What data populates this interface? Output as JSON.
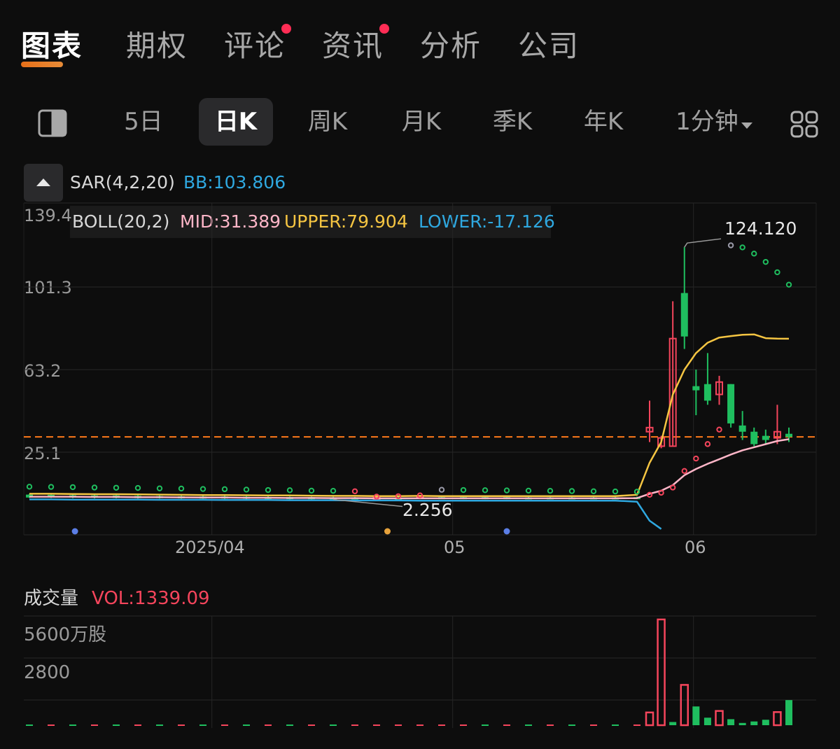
{
  "tabs": [
    {
      "label": "图表",
      "active": true
    },
    {
      "label": "期权",
      "active": false
    },
    {
      "label": "评论",
      "active": false,
      "dot": true
    },
    {
      "label": "资讯",
      "active": false,
      "dot": true
    },
    {
      "label": "分析",
      "active": false
    },
    {
      "label": "公司",
      "active": false
    }
  ],
  "periods": [
    {
      "label": "5日",
      "active": false
    },
    {
      "label": "日K",
      "active": true
    },
    {
      "label": "周K",
      "active": false
    },
    {
      "label": "月K",
      "active": false
    },
    {
      "label": "季K",
      "active": false
    },
    {
      "label": "年K",
      "active": false
    },
    {
      "label": "1分钟",
      "active": false,
      "dropdown": true
    }
  ],
  "icons": {
    "layout": "split-view-icon",
    "grid": "grid-icon",
    "collapse": "chevron-up-icon",
    "dropdown": "caret-down-icon"
  },
  "indicators": {
    "sar": {
      "label": "SAR(4,2,20)",
      "bb": "BB:103.806"
    },
    "boll": {
      "label": "BOLL(20,2)",
      "mid": "MID:31.389",
      "upper": "UPPER:79.904",
      "lower": "LOWER:-17.126"
    }
  },
  "colors": {
    "up": "#f5455c",
    "down": "#1fbe5f",
    "mid": "#ffb6c8",
    "upper": "#f5c542",
    "lower": "#2fa8e0",
    "last_price": "#ff7a1a",
    "bb": "#2fa8e0"
  },
  "chart_data": [
    {
      "type": "candlestick",
      "y_ticks": [
        "139.4",
        "101.3",
        "63.2",
        "25.1"
      ],
      "ylim": [
        -12,
        139.4
      ],
      "x_ticks": [
        {
          "label": "2025/04",
          "index": 8
        },
        {
          "label": "05",
          "index": 18
        },
        {
          "label": "06",
          "index": 28
        }
      ],
      "annotations": {
        "high": "124.120",
        "low": "2.256"
      },
      "last_price": 32.5,
      "candles": [
        {
          "o": 4.6,
          "h": 5,
          "l": 3,
          "c": 3.2
        },
        {
          "o": 4.5,
          "h": 4.8,
          "l": 3,
          "c": 3.3
        },
        {
          "o": 4.3,
          "h": 4.6,
          "l": 2.9,
          "c": 3.2
        },
        {
          "o": 4.2,
          "h": 4.5,
          "l": 2.8,
          "c": 3.1
        },
        {
          "o": 4.2,
          "h": 4.4,
          "l": 2.8,
          "c": 3
        },
        {
          "o": 4.0,
          "h": 4.3,
          "l": 2.7,
          "c": 2.9
        },
        {
          "o": 3.9,
          "h": 4.2,
          "l": 2.7,
          "c": 2.9
        },
        {
          "o": 3.8,
          "h": 4.1,
          "l": 2.6,
          "c": 2.8
        },
        {
          "o": 3.7,
          "h": 4.0,
          "l": 2.6,
          "c": 2.8
        },
        {
          "o": 3.7,
          "h": 4.0,
          "l": 2.5,
          "c": 2.7
        },
        {
          "o": 3.6,
          "h": 3.9,
          "l": 2.4,
          "c": 2.6
        },
        {
          "o": 3.5,
          "h": 3.8,
          "l": 2.3,
          "c": 2.5
        },
        {
          "o": 3.5,
          "h": 3.7,
          "l": 2.3,
          "c": 2.4
        },
        {
          "o": 3.4,
          "h": 3.6,
          "l": 2.3,
          "c": 2.4
        },
        {
          "o": 3.3,
          "h": 3.6,
          "l": 2.256,
          "c": 2.4
        },
        {
          "o": 3.3,
          "h": 3.5,
          "l": 2.3,
          "c": 2.5
        },
        {
          "o": 3.0,
          "h": 3.4,
          "l": 2.3,
          "c": 3.3
        },
        {
          "o": 3.2,
          "h": 3.5,
          "l": 2.4,
          "c": 2.6
        },
        {
          "o": 3.5,
          "h": 4.2,
          "l": 2.5,
          "c": 4
        },
        {
          "o": 3.4,
          "h": 3.7,
          "l": 2.5,
          "c": 2.7
        },
        {
          "o": 3.4,
          "h": 3.7,
          "l": 2.4,
          "c": 2.6
        },
        {
          "o": 3.4,
          "h": 3.6,
          "l": 2.4,
          "c": 2.6
        },
        {
          "o": 3.4,
          "h": 3.6,
          "l": 2.4,
          "c": 2.5
        },
        {
          "o": 3.3,
          "h": 3.6,
          "l": 2.3,
          "c": 2.5
        },
        {
          "o": 3.3,
          "h": 3.6,
          "l": 2.3,
          "c": 2.5
        },
        {
          "o": 3.3,
          "h": 3.6,
          "l": 2.3,
          "c": 2.5
        },
        {
          "o": 3.3,
          "h": 3.6,
          "l": 2.3,
          "c": 2.5
        },
        {
          "o": 3.3,
          "h": 3.6,
          "l": 2.4,
          "c": 2.6
        },
        {
          "o": 3.4,
          "h": 3.7,
          "l": 2.5,
          "c": 2.7
        },
        {
          "o": 35,
          "h": 50,
          "l": 30,
          "c": 37
        },
        {
          "o": 28,
          "h": 33,
          "l": 27,
          "c": 32
        },
        {
          "o": 28,
          "h": 98,
          "l": 28,
          "c": 80
        },
        {
          "o": 102,
          "h": 124.12,
          "l": 75,
          "c": 81
        },
        {
          "o": 57,
          "h": 65,
          "l": 43,
          "c": 55
        },
        {
          "o": 58,
          "h": 73,
          "l": 48,
          "c": 50
        },
        {
          "o": 53,
          "h": 62,
          "l": 48,
          "c": 59
        },
        {
          "o": 58,
          "h": 58,
          "l": 37,
          "c": 39
        },
        {
          "o": 38,
          "h": 45,
          "l": 31,
          "c": 35
        },
        {
          "o": 35,
          "h": 37,
          "l": 28,
          "c": 29
        },
        {
          "o": 33,
          "h": 36,
          "l": 29,
          "c": 31
        },
        {
          "o": 32,
          "h": 48,
          "l": 29,
          "c": 35
        },
        {
          "o": 34,
          "h": 37,
          "l": 30,
          "c": 32.5
        }
      ],
      "boll_mid": [
        3.6,
        3.6,
        3.6,
        3.5,
        3.5,
        3.4,
        3.4,
        3.3,
        3.2,
        3.2,
        3.1,
        3.1,
        3,
        3,
        2.9,
        2.9,
        2.8,
        2.8,
        2.8,
        2.8,
        2.8,
        2.8,
        2.8,
        2.8,
        2.8,
        2.8,
        2.8,
        2.8,
        2.9,
        5,
        6.5,
        9.2,
        14,
        17,
        19.5,
        21.7,
        24,
        26,
        27.5,
        29,
        30.5,
        31.389
      ],
      "boll_upper": [
        5,
        5,
        4.9,
        4.8,
        4.8,
        4.7,
        4.6,
        4.5,
        4.4,
        4.4,
        4.3,
        4.2,
        4.2,
        4.1,
        4,
        4,
        3.9,
        3.9,
        4,
        3.9,
        3.9,
        3.9,
        3.9,
        3.9,
        3.9,
        3.9,
        3.9,
        3.9,
        4.5,
        20,
        30,
        53,
        65,
        73,
        78,
        80.5,
        81.2,
        81.8,
        82,
        80.2,
        80,
        79.904
      ],
      "boll_lower": [
        2.3,
        2.3,
        2.2,
        2.2,
        2.2,
        2.2,
        2.1,
        2.1,
        2.1,
        2,
        2,
        2,
        1.9,
        1.9,
        1.9,
        1.8,
        1.8,
        1.8,
        1.7,
        1.7,
        1.7,
        1.7,
        1.7,
        1.7,
        1.7,
        1.7,
        1.7,
        1.7,
        1.2,
        -8,
        -12
      ],
      "sar": [
        {
          "i": 0,
          "v": 6.4,
          "c": "#1fbe5f"
        },
        {
          "i": 1,
          "v": 6.3,
          "c": "#1fbe5f"
        },
        {
          "i": 2,
          "v": 6.2,
          "c": "#1fbe5f"
        },
        {
          "i": 3,
          "v": 6.0,
          "c": "#1fbe5f"
        },
        {
          "i": 4,
          "v": 5.9,
          "c": "#1fbe5f"
        },
        {
          "i": 5,
          "v": 5.8,
          "c": "#1fbe5f"
        },
        {
          "i": 6,
          "v": 5.6,
          "c": "#1fbe5f"
        },
        {
          "i": 7,
          "v": 5.5,
          "c": "#1fbe5f"
        },
        {
          "i": 8,
          "v": 5.3,
          "c": "#1fbe5f"
        },
        {
          "i": 9,
          "v": 5.2,
          "c": "#1fbe5f"
        },
        {
          "i": 10,
          "v": 5.0,
          "c": "#1fbe5f"
        },
        {
          "i": 11,
          "v": 4.8,
          "c": "#1fbe5f"
        },
        {
          "i": 12,
          "v": 4.7,
          "c": "#1fbe5f"
        },
        {
          "i": 13,
          "v": 4.5,
          "c": "#1fbe5f"
        },
        {
          "i": 14,
          "v": 4.4,
          "c": "#1fbe5f"
        },
        {
          "i": 15,
          "v": 4.2,
          "c": "#f5455c"
        },
        {
          "i": 16,
          "v": 1.6,
          "c": "#f5455c"
        },
        {
          "i": 17,
          "v": 1.8,
          "c": "#f5455c"
        },
        {
          "i": 18,
          "v": 2.2,
          "c": "#f5455c"
        },
        {
          "i": 19,
          "v": 4.9,
          "c": "#9a9aa8"
        },
        {
          "i": 20,
          "v": 4.8,
          "c": "#1fbe5f"
        },
        {
          "i": 21,
          "v": 4.7,
          "c": "#1fbe5f"
        },
        {
          "i": 22,
          "v": 4.6,
          "c": "#1fbe5f"
        },
        {
          "i": 23,
          "v": 4.5,
          "c": "#1fbe5f"
        },
        {
          "i": 24,
          "v": 4.4,
          "c": "#1fbe5f"
        },
        {
          "i": 25,
          "v": 4.3,
          "c": "#1fbe5f"
        },
        {
          "i": 26,
          "v": 4.2,
          "c": "#1fbe5f"
        },
        {
          "i": 27,
          "v": 4.1,
          "c": "#1fbe5f"
        },
        {
          "i": 28,
          "v": 4.0,
          "c": "#1fbe5f"
        },
        {
          "i": 29,
          "v": 2.5,
          "c": "#f5455c"
        },
        {
          "i": 30,
          "v": 3.5,
          "c": "#f5455c"
        },
        {
          "i": 31,
          "v": 6,
          "c": "#f5455c"
        },
        {
          "i": 32,
          "v": 14,
          "c": "#f5455c"
        },
        {
          "i": 33,
          "v": 20,
          "c": "#f5455c"
        },
        {
          "i": 34,
          "v": 27,
          "c": "#f5455c"
        },
        {
          "i": 35,
          "v": 34,
          "c": "#f5455c"
        },
        {
          "i": 36,
          "v": 123,
          "c": "#9a9aa8"
        },
        {
          "i": 37,
          "v": 122,
          "c": "#1fbe5f"
        },
        {
          "i": 38,
          "v": 119,
          "c": "#1fbe5f"
        },
        {
          "i": 39,
          "v": 115,
          "c": "#1fbe5f"
        },
        {
          "i": 40,
          "v": 110,
          "c": "#1fbe5f"
        },
        {
          "i": 41,
          "v": 104,
          "c": "#1fbe5f"
        }
      ],
      "markers": [
        {
          "i": -3,
          "c": "#5b7ee6"
        },
        {
          "i": 16.5,
          "c": "#e6a23c"
        },
        {
          "i": 22,
          "c": "#5b7ee6"
        }
      ]
    },
    {
      "type": "bar",
      "title": "成交量",
      "value_label": "VOL:1339.09",
      "y_ticks": [
        "5600万股",
        "2800"
      ],
      "ylim": [
        0,
        5600
      ],
      "values": [
        20,
        20,
        20,
        20,
        20,
        20,
        20,
        20,
        20,
        20,
        20,
        20,
        20,
        20,
        20,
        20,
        20,
        20,
        20,
        20,
        20,
        20,
        20,
        20,
        20,
        20,
        20,
        20,
        20,
        680,
        5640,
        170,
        2150,
        1000,
        400,
        760,
        320,
        120,
        200,
        290,
        700,
        1340
      ],
      "colors": [
        "#1fbe5f",
        "#f5455c",
        "#1fbe5f",
        "#f5455c",
        "#1fbe5f",
        "#f5455c",
        "#1fbe5f",
        "#f5455c",
        "#1fbe5f",
        "#f5455c",
        "#1fbe5f",
        "#f5455c",
        "#1fbe5f",
        "#f5455c",
        "#1fbe5f",
        "#f5455c",
        "#f5455c",
        "#f5455c",
        "#f5455c",
        "#f5455c",
        "#f5455c",
        "#1fbe5f",
        "#f5455c",
        "#1fbe5f",
        "#f5455c",
        "#1fbe5f",
        "#f5455c",
        "#1fbe5f",
        "#f5455c",
        "#f5455c",
        "#f5455c",
        "#1fbe5f",
        "#f5455c",
        "#1fbe5f",
        "#1fbe5f",
        "#f5455c",
        "#1fbe5f",
        "#1fbe5f",
        "#1fbe5f",
        "#1fbe5f",
        "#f5455c",
        "#1fbe5f"
      ]
    }
  ]
}
